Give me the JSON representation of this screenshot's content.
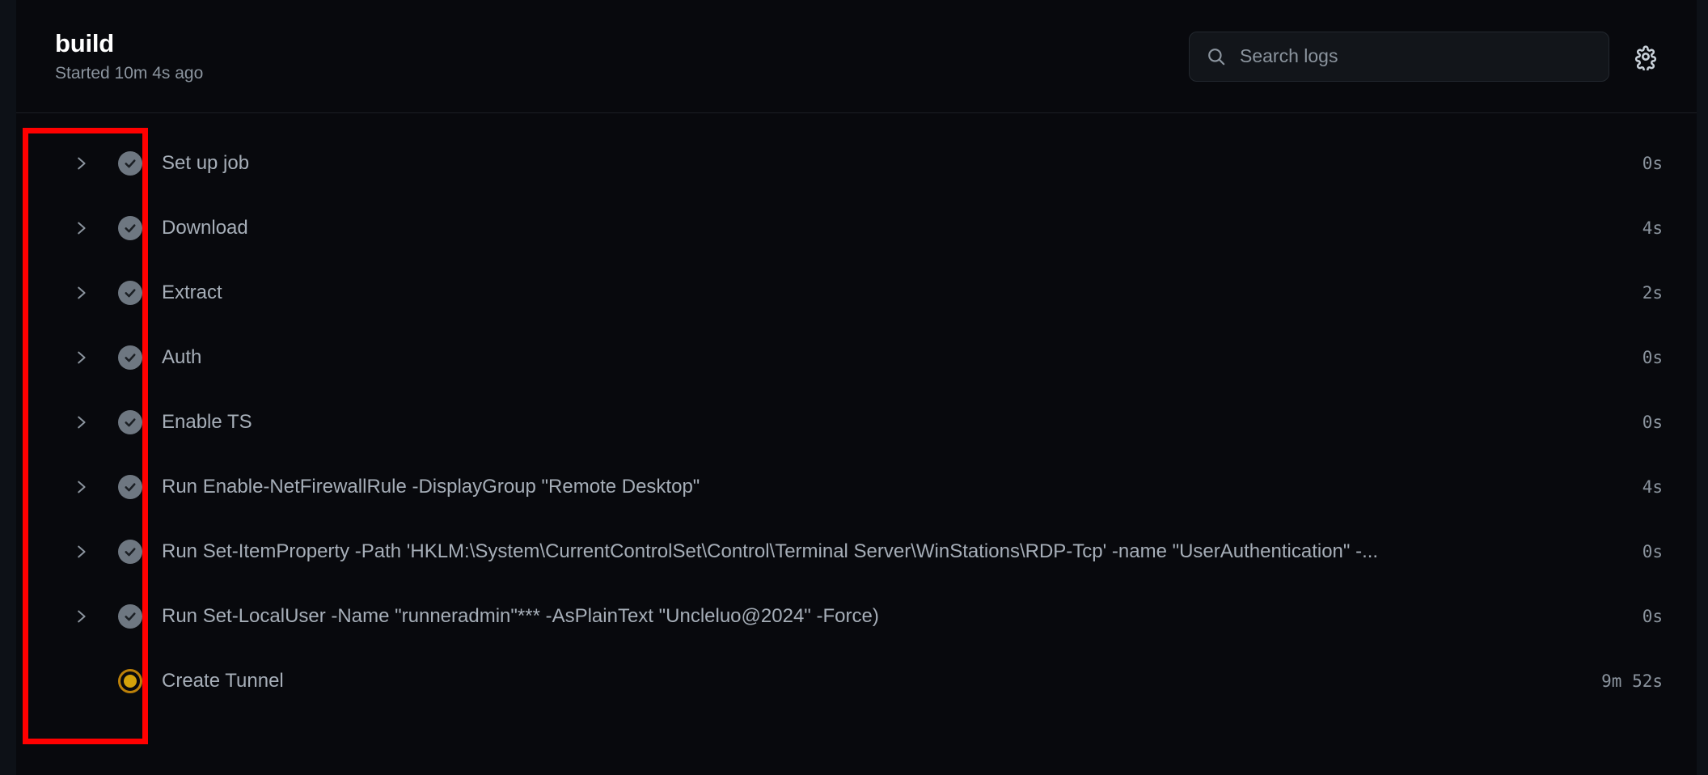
{
  "header": {
    "title": "build",
    "subtitle": "Started 10m 4s ago",
    "search": {
      "placeholder": "Search logs",
      "value": "",
      "icon": "search-icon"
    },
    "settings_icon": "gear-icon"
  },
  "steps": [
    {
      "label": "Set up job",
      "duration": "0s",
      "status": "success",
      "expandable": true,
      "chevron": "chevron-right-icon"
    },
    {
      "label": "Download",
      "duration": "4s",
      "status": "success",
      "expandable": true,
      "chevron": "chevron-right-icon"
    },
    {
      "label": "Extract",
      "duration": "2s",
      "status": "success",
      "expandable": true,
      "chevron": "chevron-right-icon"
    },
    {
      "label": "Auth",
      "duration": "0s",
      "status": "success",
      "expandable": true,
      "chevron": "chevron-right-icon"
    },
    {
      "label": "Enable TS",
      "duration": "0s",
      "status": "success",
      "expandable": true,
      "chevron": "chevron-right-icon"
    },
    {
      "label": "Run Enable-NetFirewallRule -DisplayGroup \"Remote Desktop\"",
      "duration": "4s",
      "status": "success",
      "expandable": true,
      "chevron": "chevron-right-icon"
    },
    {
      "label": "Run Set-ItemProperty -Path 'HKLM:\\System\\CurrentControlSet\\Control\\Terminal Server\\WinStations\\RDP-Tcp' -name \"UserAuthentication\" -...",
      "duration": "0s",
      "status": "success",
      "expandable": true,
      "chevron": "chevron-right-icon"
    },
    {
      "label": "Run Set-LocalUser -Name \"runneradmin\"*** -AsPlainText \"Uncleluo@2024\" -Force)",
      "duration": "0s",
      "status": "success",
      "expandable": true,
      "chevron": "chevron-right-icon"
    },
    {
      "label": "Create Tunnel",
      "duration": "9m 52s",
      "status": "running",
      "expandable": false,
      "chevron": ""
    }
  ],
  "annotation": {
    "type": "highlight-rectangle",
    "color": "#ff0000"
  },
  "colors": {
    "background": "#08090d",
    "gutter": "#0d1117",
    "title_text": "#ffffff",
    "muted_text": "#8b949e",
    "step_text": "#a6aeb8",
    "success_icon": "#6e7781",
    "running_icon": "#d4a20a",
    "annotation": "#ff0000",
    "divider": "#1b1f24"
  }
}
